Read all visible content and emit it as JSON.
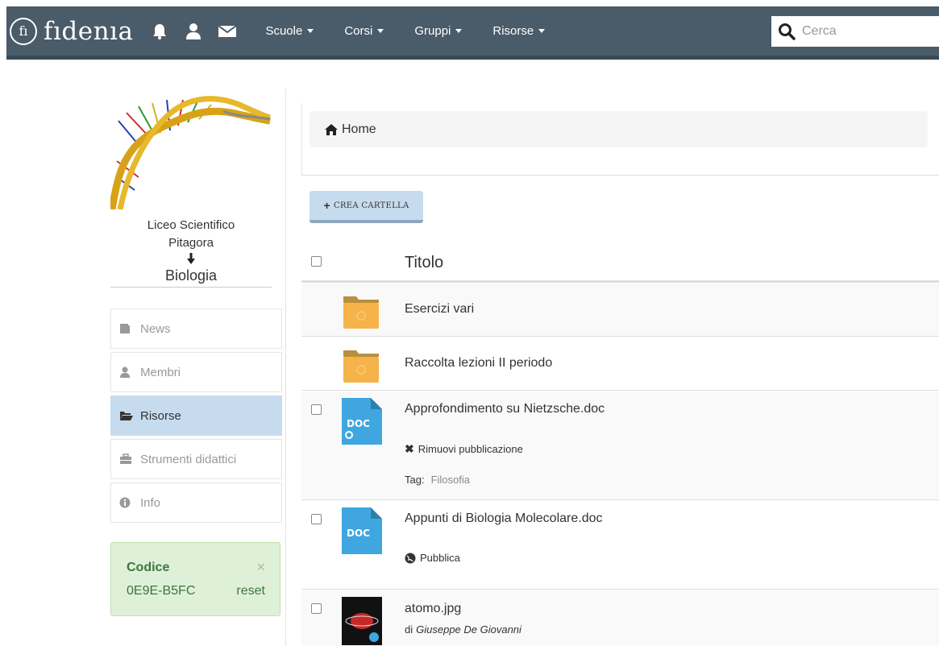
{
  "navbar": {
    "logo_badge": "fı",
    "logo_text": "fıdenıa",
    "menu": [
      {
        "label": "Scuole"
      },
      {
        "label": "Corsi"
      },
      {
        "label": "Gruppi"
      },
      {
        "label": "Risorse"
      }
    ],
    "search_placeholder": "Cerca",
    "bg_color": "#4a5b69"
  },
  "sidebar": {
    "school_name_line1": "Liceo Scientifico",
    "school_name_line2": "Pitagora",
    "arrow": "🡓",
    "course_name": "Biologia",
    "items": [
      {
        "label": "News",
        "icon": "news-icon",
        "active": false
      },
      {
        "label": "Membri",
        "icon": "user-icon",
        "active": false
      },
      {
        "label": "Risorse",
        "icon": "folder-open-icon",
        "active": true
      },
      {
        "label": "Strumenti didattici",
        "icon": "briefcase-icon",
        "active": false
      },
      {
        "label": "Info",
        "icon": "info-icon",
        "active": false
      }
    ],
    "code_box": {
      "title": "Codice",
      "close": "×",
      "value": "0E9E-B5FC",
      "reset": "reset"
    }
  },
  "main": {
    "breadcrumb": "Home",
    "create_folder_label": "CREA CARTELLA",
    "create_folder_plus": "+",
    "table_header_title": "Titolo",
    "rows": [
      {
        "type": "folder",
        "title": "Esercizi vari"
      },
      {
        "type": "folder",
        "title": "Raccolta lezioni II periodo"
      },
      {
        "type": "doc",
        "title": "Approfondimento su Nietzsche.doc",
        "action": "Rimuovi pubblicazione",
        "action_glyph": "✖",
        "tag_label": "Tag:",
        "tag": "Filosofia"
      },
      {
        "type": "doc",
        "title": "Appunti di Biologia Molecolare.doc",
        "action": "Pubblica"
      },
      {
        "type": "image",
        "title": "atomo.jpg",
        "author_prefix": "di",
        "author": "Giuseppe De Giovanni"
      }
    ],
    "doc_label": "DOC"
  },
  "colors": {
    "accent_light_blue": "#c7dbee",
    "folder": "#f6b34a",
    "doc": "#3fa6e0",
    "success_bg": "#dff0d8"
  }
}
